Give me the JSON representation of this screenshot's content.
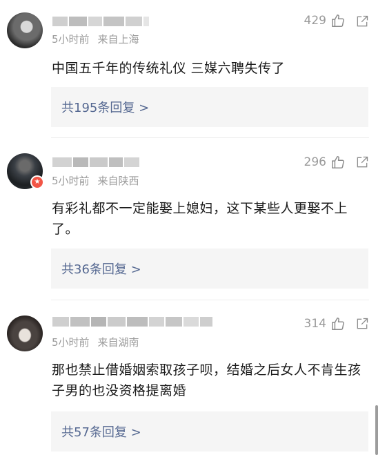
{
  "comments": [
    {
      "meta_time": "5小时前",
      "meta_location": "来自上海",
      "likes": "429",
      "text": "中国五千年的传统礼仪 三媒六聘失传了",
      "reply_label": "共195条回复 >",
      "avatar_icon": "user-avatar-dark-hair",
      "verified": false
    },
    {
      "meta_time": "5小时前",
      "meta_location": "来自陕西",
      "likes": "296",
      "text": "有彩礼都不一定能娶上媳妇，这下某些人更娶不上了。",
      "reply_label": "共36条回复 >",
      "avatar_icon": "user-avatar-photo",
      "verified": true
    },
    {
      "meta_time": "5小时前",
      "meta_location": "来自湖南",
      "likes": "314",
      "text": "那也禁止借婚姻索取孩子呗，结婚之后女人不肯生孩子男的也没资格提离婚",
      "reply_label": "共57条回复 >",
      "avatar_icon": "user-avatar-anime",
      "verified": false
    }
  ],
  "icons": {
    "like": "thumb-up-icon",
    "share": "share-icon"
  },
  "colors": {
    "reply_link": "#556891",
    "meta": "#9a9a9a",
    "verified_badge": "#f25546"
  }
}
